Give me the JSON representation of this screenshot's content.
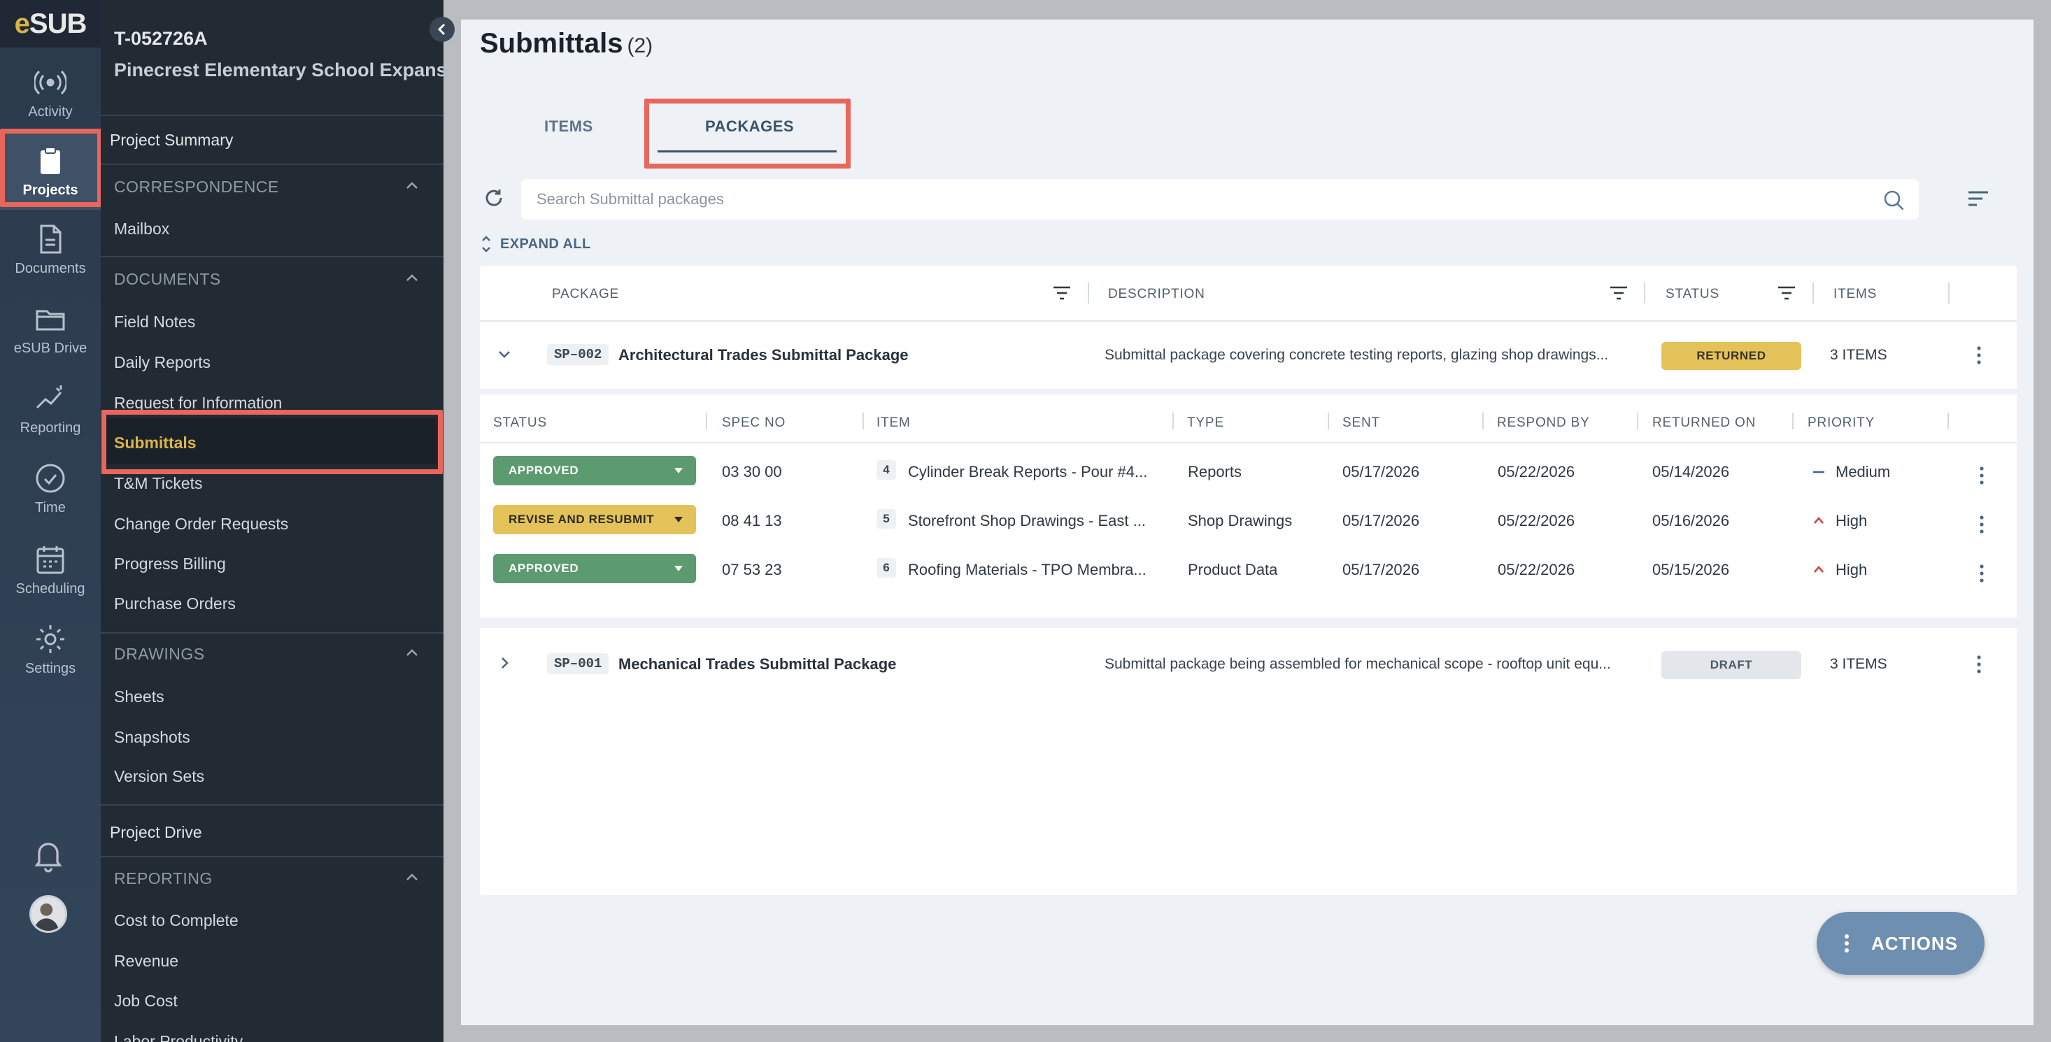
{
  "app": {
    "logo_text_accent": "e",
    "logo_text": "SUB"
  },
  "rail": {
    "items": [
      {
        "label": "Activity",
        "icon": "activity-icon"
      },
      {
        "label": "Projects",
        "icon": "clipboard-icon",
        "active": true
      },
      {
        "label": "Documents",
        "icon": "document-icon"
      },
      {
        "label": "eSUB Drive",
        "icon": "folder-icon"
      },
      {
        "label": "Reporting",
        "icon": "chart-icon"
      },
      {
        "label": "Time",
        "icon": "clock-icon"
      },
      {
        "label": "Scheduling",
        "icon": "calendar-icon"
      },
      {
        "label": "Settings",
        "icon": "gear-icon"
      }
    ],
    "bottom": [
      {
        "icon": "bell-icon"
      },
      {
        "icon": "avatar"
      }
    ]
  },
  "project": {
    "id": "T-052726A",
    "name": "Pinecrest Elementary School Expansion",
    "summary_label": "Project Summary",
    "sections": {
      "correspondence": {
        "title": "CORRESPONDENCE",
        "items": [
          "Mailbox"
        ]
      },
      "documents": {
        "title": "DOCUMENTS",
        "items": [
          "Field Notes",
          "Daily Reports",
          "Request for Information",
          "Submittals",
          "T&M Tickets",
          "Change Order Requests",
          "Progress Billing",
          "Purchase Orders"
        ]
      },
      "drawings": {
        "title": "DRAWINGS",
        "items": [
          "Sheets",
          "Snapshots",
          "Version Sets"
        ]
      },
      "project_drive": "Project Drive",
      "reporting": {
        "title": "REPORTING",
        "items": [
          "Cost to Complete",
          "Revenue",
          "Job Cost",
          "Labor Productivity"
        ]
      }
    }
  },
  "main": {
    "title": "Submittals",
    "count": "(2)",
    "tabs": [
      "ITEMS",
      "PACKAGES"
    ],
    "active_tab": "PACKAGES",
    "search_placeholder": "Search Submittal packages",
    "expand_all": "EXPAND ALL",
    "columns": [
      "PACKAGE",
      "DESCRIPTION",
      "STATUS",
      "ITEMS"
    ],
    "packages": [
      {
        "code": "SP–002",
        "name": "Architectural Trades Submittal Package",
        "description": "Submittal package covering concrete testing reports, glazing shop drawings...",
        "status": "RETURNED",
        "items_count": "3 ITEMS",
        "expanded": true
      },
      {
        "code": "SP–001",
        "name": "Mechanical Trades Submittal Package",
        "description": "Submittal package being assembled for mechanical scope - rooftop unit equ...",
        "status": "DRAFT",
        "items_count": "3 ITEMS",
        "expanded": false
      }
    ],
    "sub_columns": [
      "STATUS",
      "SPEC NO",
      "ITEM",
      "TYPE",
      "SENT",
      "RESPOND BY",
      "RETURNED ON",
      "PRIORITY"
    ],
    "sub_rows": [
      {
        "status": "APPROVED",
        "spec": "03 30 00",
        "num": "4",
        "item": "Cylinder Break Reports - Pour #4...",
        "type": "Reports",
        "sent": "05/17/2026",
        "respond_by": "05/22/2026",
        "returned_on": "05/14/2026",
        "priority": "Medium"
      },
      {
        "status": "REVISE AND RESUBMIT",
        "spec": "08 41 13",
        "num": "5",
        "item": "Storefront Shop Drawings - East ...",
        "type": "Shop Drawings",
        "sent": "05/17/2026",
        "respond_by": "05/22/2026",
        "returned_on": "05/16/2026",
        "priority": "High"
      },
      {
        "status": "APPROVED",
        "spec": "07 53 23",
        "num": "6",
        "item": "Roofing Materials - TPO Membra...",
        "type": "Product Data",
        "sent": "05/17/2026",
        "respond_by": "05/22/2026",
        "returned_on": "05/15/2026",
        "priority": "High"
      }
    ],
    "actions_label": "ACTIONS"
  },
  "colors": {
    "accent_gold": "#d8b54a",
    "approved": "#5c9a70",
    "revise": "#e4c25a",
    "highlight": "#e8665b",
    "actions": "#6f8fb1"
  }
}
